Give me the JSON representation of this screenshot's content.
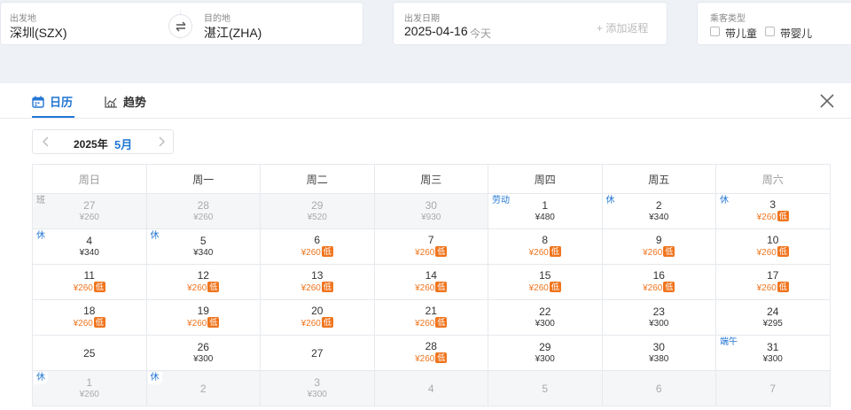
{
  "search": {
    "from_label": "出发地",
    "from_value": "深圳(SZX)",
    "to_label": "目的地",
    "to_value": "湛江(ZHA)",
    "date_label": "出发日期",
    "date_value": "2025-04-16",
    "today_text": "今天",
    "add_return": "+ 添加返程",
    "pax_label": "乘客类型",
    "child_label": "带儿童",
    "infant_label": "带婴儿"
  },
  "tabs": {
    "calendar": "日历",
    "trend": "趋势"
  },
  "month_nav": {
    "year": "2025年",
    "month": "5月"
  },
  "weekdays": [
    "周日",
    "周一",
    "周二",
    "周三",
    "周四",
    "周五",
    "周六"
  ],
  "weeks": [
    [
      {
        "day": "27",
        "price": "¥260",
        "outside": true,
        "tag": "班",
        "tag_type": "work"
      },
      {
        "day": "28",
        "price": "¥260",
        "outside": true
      },
      {
        "day": "29",
        "price": "¥520",
        "outside": true
      },
      {
        "day": "30",
        "price": "¥930",
        "outside": true
      },
      {
        "day": "1",
        "price": "¥480",
        "tag": "劳动",
        "tag_type": "holiday"
      },
      {
        "day": "2",
        "price": "¥340",
        "tag": "休",
        "tag_type": "holiday"
      },
      {
        "day": "3",
        "price": "¥260",
        "low": true,
        "tag": "休",
        "tag_type": "holiday"
      }
    ],
    [
      {
        "day": "4",
        "price": "¥340",
        "tag": "休",
        "tag_type": "holiday"
      },
      {
        "day": "5",
        "price": "¥340",
        "tag": "休",
        "tag_type": "holiday"
      },
      {
        "day": "6",
        "price": "¥260",
        "low": true
      },
      {
        "day": "7",
        "price": "¥260",
        "low": true
      },
      {
        "day": "8",
        "price": "¥260",
        "low": true
      },
      {
        "day": "9",
        "price": "¥260",
        "low": true
      },
      {
        "day": "10",
        "price": "¥260",
        "low": true
      }
    ],
    [
      {
        "day": "11",
        "price": "¥260",
        "low": true
      },
      {
        "day": "12",
        "price": "¥260",
        "low": true
      },
      {
        "day": "13",
        "price": "¥260",
        "low": true
      },
      {
        "day": "14",
        "price": "¥260",
        "low": true
      },
      {
        "day": "15",
        "price": "¥260",
        "low": true
      },
      {
        "day": "16",
        "price": "¥260",
        "low": true
      },
      {
        "day": "17",
        "price": "¥260",
        "low": true
      }
    ],
    [
      {
        "day": "18",
        "price": "¥260",
        "low": true
      },
      {
        "day": "19",
        "price": "¥260",
        "low": true
      },
      {
        "day": "20",
        "price": "¥260",
        "low": true
      },
      {
        "day": "21",
        "price": "¥260",
        "low": true
      },
      {
        "day": "22",
        "price": "¥300"
      },
      {
        "day": "23",
        "price": "¥300"
      },
      {
        "day": "24",
        "price": "¥295"
      }
    ],
    [
      {
        "day": "25",
        "price": ""
      },
      {
        "day": "26",
        "price": "¥300"
      },
      {
        "day": "27",
        "price": ""
      },
      {
        "day": "28",
        "price": "¥260",
        "low": true
      },
      {
        "day": "29",
        "price": "¥300"
      },
      {
        "day": "30",
        "price": "¥380"
      },
      {
        "day": "31",
        "price": "¥300",
        "tag": "端午",
        "tag_type": "holiday"
      }
    ],
    [
      {
        "day": "1",
        "price": "¥260",
        "outside": true,
        "tag": "休",
        "tag_type": "holiday"
      },
      {
        "day": "2",
        "price": "",
        "outside": true,
        "tag": "休",
        "tag_type": "holiday"
      },
      {
        "day": "3",
        "price": "¥300",
        "outside": true
      },
      {
        "day": "4",
        "price": "",
        "outside": true
      },
      {
        "day": "5",
        "price": "",
        "outside": true
      },
      {
        "day": "6",
        "price": "",
        "outside": true
      },
      {
        "day": "7",
        "price": "",
        "outside": true
      }
    ]
  ],
  "low_badge": "低",
  "colors": {
    "accent": "#2276d4",
    "low_price": "#f0751e"
  }
}
